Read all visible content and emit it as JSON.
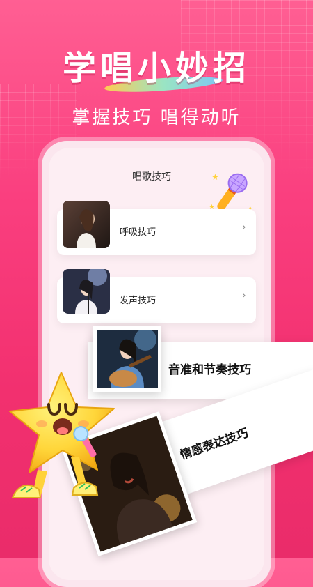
{
  "hero": {
    "title": "学唱小妙招",
    "subtitle": "掌握技巧 唱得动听"
  },
  "section": {
    "title": "唱歌技巧"
  },
  "items": [
    {
      "label": "呼吸技巧",
      "chevron": "›"
    },
    {
      "label": "发声技巧",
      "chevron": "›"
    },
    {
      "label": "音准和节奏技巧"
    },
    {
      "label": "情感表达技巧"
    }
  ],
  "icons": {
    "mic": "microphone-icon",
    "mascot": "star-mascot"
  },
  "colors": {
    "background_top": "#ff5f93",
    "background_bottom": "#ea2c6a",
    "card": "#ffffff",
    "panel": "#fdeef3",
    "mascot": "#ffd43b"
  }
}
